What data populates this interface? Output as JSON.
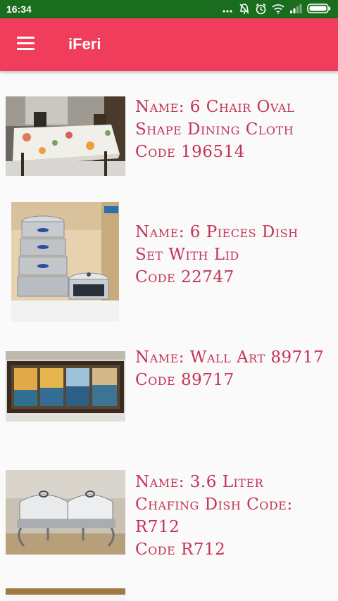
{
  "status_bar": {
    "time": "16:34",
    "icons": [
      "more-dots-icon",
      "mute-icon",
      "alarm-icon",
      "wifi-icon",
      "signal-icon",
      "battery-icon"
    ]
  },
  "app_bar": {
    "title": "iFeri",
    "menu_icon": "hamburger-menu-icon",
    "color": "#f13d5c"
  },
  "products": [
    {
      "name": "Name: 6 Chair Oval Shape Dining Cloth",
      "code": "Code 196514"
    },
    {
      "name": "Name: 6 Pieces Dish Set With Lid",
      "code": "Code 22747"
    },
    {
      "name": "Name: Wall Art 89717",
      "code": "Code 89717"
    },
    {
      "name": "Name: 3.6 Liter Chafing Dish Code: R712",
      "code": "Code R712"
    }
  ],
  "colors": {
    "status_bar": "#1a6d1e",
    "item_text": "#c43355",
    "background": "#fafafa"
  }
}
